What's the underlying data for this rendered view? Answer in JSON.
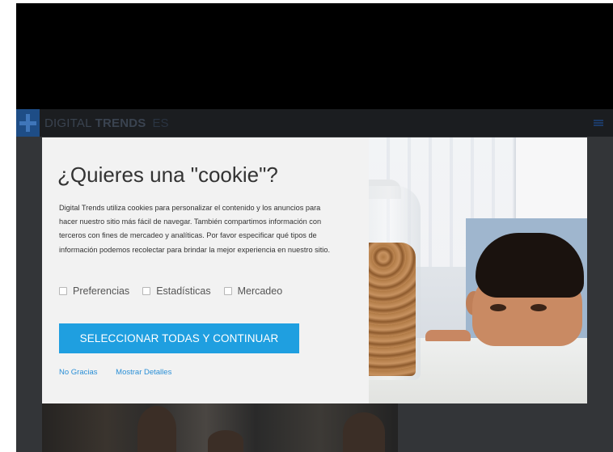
{
  "navbar": {
    "brand_light": "DIGITAL",
    "brand_bold": "TRENDS",
    "lang": "ES",
    "logo_icon": "plus-logo-icon",
    "menu_icon": "hamburger-menu-icon"
  },
  "modal": {
    "title": "¿Quieres una \"cookie\"?",
    "body": "Digital Trends utiliza cookies para personalizar el contenido y los anuncios para hacer nuestro sitio más fácil de navegar. También compartimos información con terceros con fines de mercadeo y analíticas. Por favor especificar qué tipos de información podemos recolectar para brindar la mejor experiencia en nuestro sitio.",
    "options": [
      {
        "label": "Preferencias",
        "checked": false
      },
      {
        "label": "Estadísticas",
        "checked": false
      },
      {
        "label": "Mercadeo",
        "checked": false
      }
    ],
    "cta_label": "SELECCIONAR TODAS Y CONTINUAR",
    "link_decline": "No Gracias",
    "link_details": "Mostrar Detalles"
  },
  "colors": {
    "accent": "#1f9fe0",
    "link": "#2a8fd6",
    "logo_blue": "#1e4d86"
  }
}
